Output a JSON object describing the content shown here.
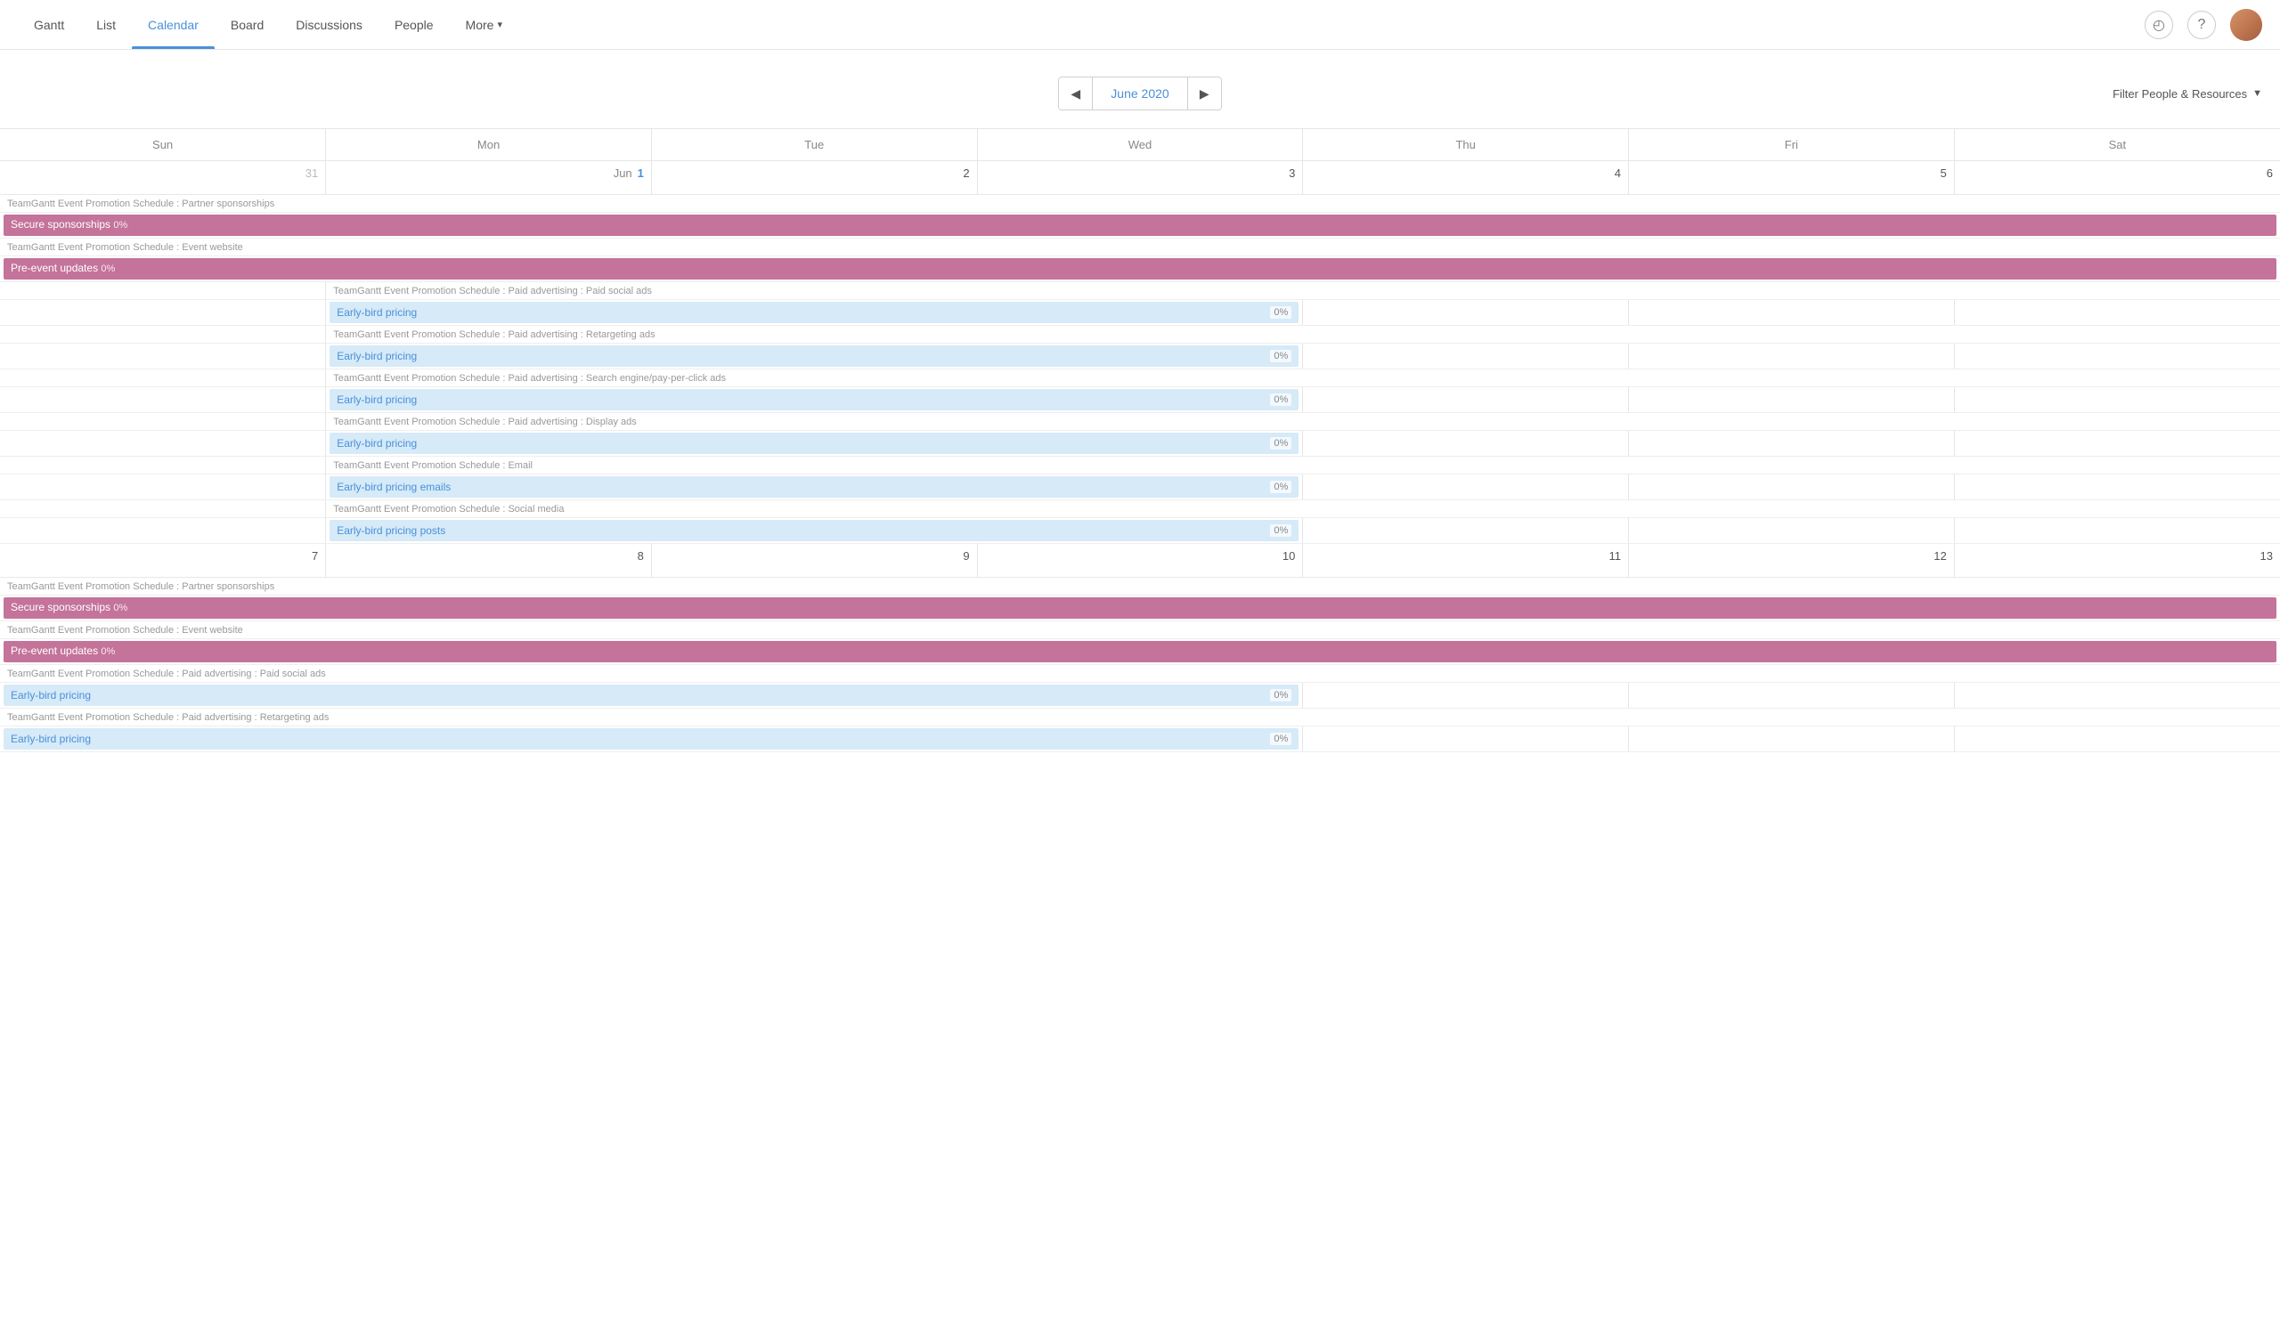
{
  "nav": {
    "items": [
      {
        "label": "Gantt",
        "active": false
      },
      {
        "label": "List",
        "active": false
      },
      {
        "label": "Calendar",
        "active": true
      },
      {
        "label": "Board",
        "active": false
      },
      {
        "label": "Discussions",
        "active": false
      },
      {
        "label": "People",
        "active": false
      },
      {
        "label": "More",
        "active": false,
        "dropdown": true
      }
    ]
  },
  "toolbar": {
    "prev_label": "◀",
    "next_label": "▶",
    "current_month": "June 2020",
    "filter_label": "Filter People & Resources",
    "filter_arrow": "▼"
  },
  "calendar": {
    "days": [
      "Sun",
      "Mon",
      "Tue",
      "Wed",
      "Thu",
      "Fri",
      "Sat"
    ],
    "week1": {
      "days": [
        "31",
        "Jun  1",
        "2",
        "3",
        "4",
        "5",
        "6"
      ],
      "breadcrumb1": "TeamGantt Event Promotion Schedule : Partner sponsorships",
      "bar1_label": "Secure sponsorships",
      "bar1_pct": "0%",
      "breadcrumb2": "TeamGantt Event Promotion Schedule : Event website",
      "bar2_label": "Pre-event updates",
      "bar2_pct": "0%",
      "sub_items": [
        {
          "breadcrumb": "TeamGantt Event Promotion Schedule : Paid advertising : Paid social ads",
          "bar_label": "Early-bird pricing",
          "bar_pct": "0%"
        },
        {
          "breadcrumb": "TeamGantt Event Promotion Schedule : Paid advertising : Retargeting ads",
          "bar_label": "Early-bird pricing",
          "bar_pct": "0%"
        },
        {
          "breadcrumb": "TeamGantt Event Promotion Schedule : Paid advertising : Search engine/pay-per-click ads",
          "bar_label": "Early-bird pricing",
          "bar_pct": "0%"
        },
        {
          "breadcrumb": "TeamGantt Event Promotion Schedule : Paid advertising : Display ads",
          "bar_label": "Early-bird pricing",
          "bar_pct": "0%"
        },
        {
          "breadcrumb": "TeamGantt Event Promotion Schedule : Email",
          "bar_label": "Early-bird pricing emails",
          "bar_pct": "0%"
        },
        {
          "breadcrumb": "TeamGantt Event Promotion Schedule : Social media",
          "bar_label": "Early-bird pricing posts",
          "bar_pct": "0%"
        }
      ]
    },
    "week2": {
      "days": [
        "7",
        "8",
        "9",
        "10",
        "11",
        "12",
        "13"
      ],
      "breadcrumb1": "TeamGantt Event Promotion Schedule : Partner sponsorships",
      "bar1_label": "Secure sponsorships",
      "bar1_pct": "0%",
      "breadcrumb2": "TeamGantt Event Promotion Schedule : Event website",
      "bar2_label": "Pre-event updates",
      "bar2_pct": "0%",
      "sub_items": [
        {
          "breadcrumb": "TeamGantt Event Promotion Schedule : Paid advertising : Paid social ads",
          "bar_label": "Early-bird pricing",
          "bar_pct": "0%"
        },
        {
          "breadcrumb": "TeamGantt Event Promotion Schedule : Paid advertising : Retargeting ads",
          "bar_label": "Early-bird pricing",
          "bar_pct": "0%"
        }
      ]
    }
  }
}
